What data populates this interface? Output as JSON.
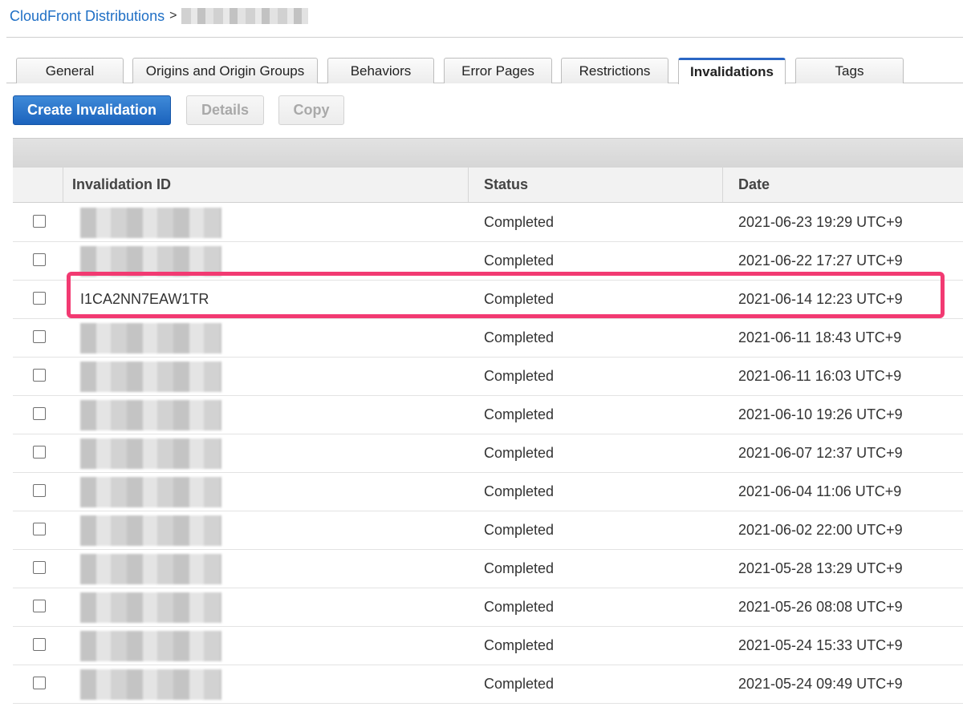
{
  "breadcrumb": {
    "link": "CloudFront Distributions",
    "separator": ">"
  },
  "tabs": [
    {
      "label": "General"
    },
    {
      "label": "Origins and Origin Groups"
    },
    {
      "label": "Behaviors"
    },
    {
      "label": "Error Pages"
    },
    {
      "label": "Restrictions"
    },
    {
      "label": "Invalidations",
      "active": true
    },
    {
      "label": "Tags"
    }
  ],
  "toolbar": {
    "create_label": "Create Invalidation",
    "details_label": "Details",
    "copy_label": "Copy"
  },
  "table": {
    "headers": {
      "id": "Invalidation ID",
      "status": "Status",
      "date": "Date"
    },
    "rows": [
      {
        "id": "",
        "status": "Completed",
        "date": "2021-06-23 19:29 UTC+9"
      },
      {
        "id": "",
        "status": "Completed",
        "date": "2021-06-22 17:27 UTC+9"
      },
      {
        "id": "I1CA2NN7EAW1TR",
        "status": "Completed",
        "date": "2021-06-14 12:23 UTC+9"
      },
      {
        "id": "",
        "status": "Completed",
        "date": "2021-06-11 18:43 UTC+9"
      },
      {
        "id": "",
        "status": "Completed",
        "date": "2021-06-11 16:03 UTC+9"
      },
      {
        "id": "",
        "status": "Completed",
        "date": "2021-06-10 19:26 UTC+9"
      },
      {
        "id": "",
        "status": "Completed",
        "date": "2021-06-07 12:37 UTC+9"
      },
      {
        "id": "",
        "status": "Completed",
        "date": "2021-06-04 11:06 UTC+9"
      },
      {
        "id": "",
        "status": "Completed",
        "date": "2021-06-02 22:00 UTC+9"
      },
      {
        "id": "",
        "status": "Completed",
        "date": "2021-05-28 13:29 UTC+9"
      },
      {
        "id": "",
        "status": "Completed",
        "date": "2021-05-26 08:08 UTC+9"
      },
      {
        "id": "",
        "status": "Completed",
        "date": "2021-05-24 15:33 UTC+9"
      },
      {
        "id": "",
        "status": "Completed",
        "date": "2021-05-24 09:49 UTC+9"
      }
    ]
  },
  "colors": {
    "link": "#1f6fc5",
    "primary_button": "#1c63bd",
    "active_tab_accent": "#2a66c4",
    "highlight_box": "#f23a72"
  }
}
